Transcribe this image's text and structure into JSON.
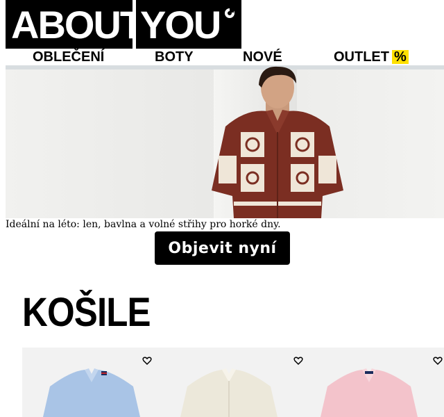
{
  "brand": {
    "logo_left": "ABOUT",
    "logo_right": "YOU"
  },
  "nav": {
    "items": [
      {
        "label": "OBLEČENÍ"
      },
      {
        "label": "BOTY"
      },
      {
        "label": "NOVÉ"
      },
      {
        "label": "OUTLET",
        "badge": "%"
      }
    ]
  },
  "hero": {
    "caption": "Ideální na léto: len, bavlna a volné střihy pro horké dny.",
    "cta_label": "Objevit nyní"
  },
  "section": {
    "title": "KOŠILE"
  },
  "products": [
    {
      "color": "#a9c4e6",
      "icon": "heart-outline-icon"
    },
    {
      "color": "#ece8da",
      "icon": "heart-outline-icon"
    },
    {
      "color": "#f3c3cb",
      "icon": "heart-outline-icon"
    }
  ],
  "colors": {
    "badge": "#ffe000",
    "cta_bg": "#000000",
    "shirt_main": "#7b2e22",
    "shirt_panel": "#efe6d8"
  }
}
